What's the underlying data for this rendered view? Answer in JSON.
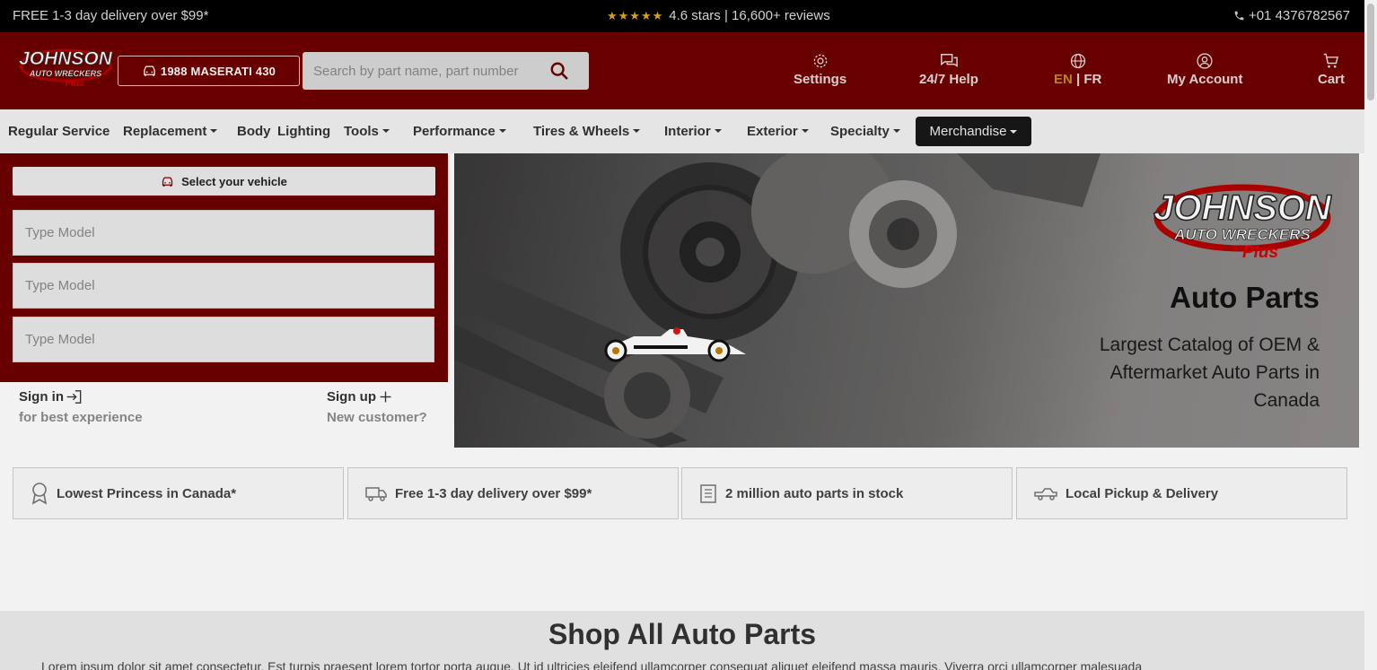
{
  "topbar": {
    "promo": "FREE 1-3 day delivery over $99*",
    "stars": "★★★★★",
    "rating": "4.6 stars | 16,600+ reviews",
    "phone": "+01 4376782567"
  },
  "header": {
    "logo_text": "JOHNSON AUTO WRECKERS Plus",
    "vehicle": "1988 MASERATI 430",
    "search_placeholder": "Search by part name, part number",
    "settings": "Settings",
    "help": "24/7 Help",
    "lang_en": "EN",
    "lang_rest": " | FR",
    "account": "My Account",
    "cart": "Cart"
  },
  "nav": {
    "regular": "Regular Service",
    "replacement": "Replacement",
    "body": "Body",
    "lighting": "Lighting",
    "tools": "Tools",
    "performance": "Performance",
    "tires": "Tires & Wheels",
    "interior": "Interior",
    "exterior": "Exterior",
    "specialty": "Specialty",
    "merchandise": "Merchandise"
  },
  "vehicle_panel": {
    "heading": "Select your vehicle",
    "field1_placeholder": "Type Model",
    "field2_placeholder": "Type Model",
    "field3_placeholder": "Type Model"
  },
  "auth": {
    "signin": "Sign in",
    "signin_sub": "for best experience",
    "signup": "Sign up",
    "signup_sub": "New customer?"
  },
  "hero": {
    "title": "Auto Parts",
    "description": "Largest Catalog of OEM & Aftermarket Auto Parts in Canada"
  },
  "features": {
    "f1": "Lowest Princess in Canada*",
    "f2": "Free 1-3 day delivery over $99*",
    "f3": "2 million auto parts in stock",
    "f4": "Local Pickup & Delivery"
  },
  "shop": {
    "title": "Shop All Auto Parts",
    "text": "Lorem ipsum dolor sit amet consectetur. Est turpis praesent lorem tortor porta augue. Ut id ultricies eleifend ullamcorper consequat aliquet eleifend massa mauris. Viverra orci ullamcorper malesuada"
  },
  "colors": {
    "brand_red": "#6e0000",
    "accent_gold": "#c68b14",
    "topbar": "#000000"
  }
}
